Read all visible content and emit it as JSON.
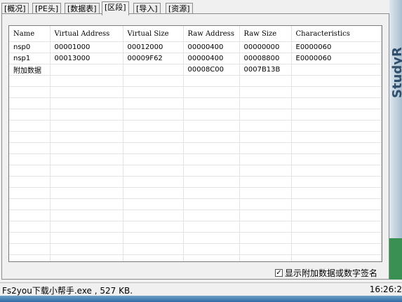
{
  "tabs": [
    {
      "label": "[概况]",
      "active": false
    },
    {
      "label": "[PE头]",
      "active": false
    },
    {
      "label": "[数据表]",
      "active": false
    },
    {
      "label": "[区段]",
      "active": true
    },
    {
      "label": "[导入]",
      "active": false
    },
    {
      "label": "[资源]",
      "active": false
    }
  ],
  "sections_table": {
    "columns": [
      "Name",
      "Virtual Address",
      "Virtual Size",
      "Raw Address",
      "Raw Size",
      "Characteristics"
    ],
    "rows": [
      [
        "nsp0",
        "00001000",
        "00012000",
        "00000400",
        "00000000",
        "E0000060"
      ],
      [
        "nsp1",
        "00013000",
        "00009F62",
        "00000400",
        "00008800",
        "E0000060"
      ],
      [
        "附加数据",
        "",
        "",
        "00008C00",
        "0007B13B",
        ""
      ]
    ]
  },
  "overlay_checkbox": {
    "label": "显示附加数据或数字签名",
    "checked": true
  },
  "status_bar": {
    "file": "Fs2you下载小帮手.exe , 527 KB.",
    "time": "16:26:2"
  },
  "background_art": {
    "text": "StudyR"
  }
}
